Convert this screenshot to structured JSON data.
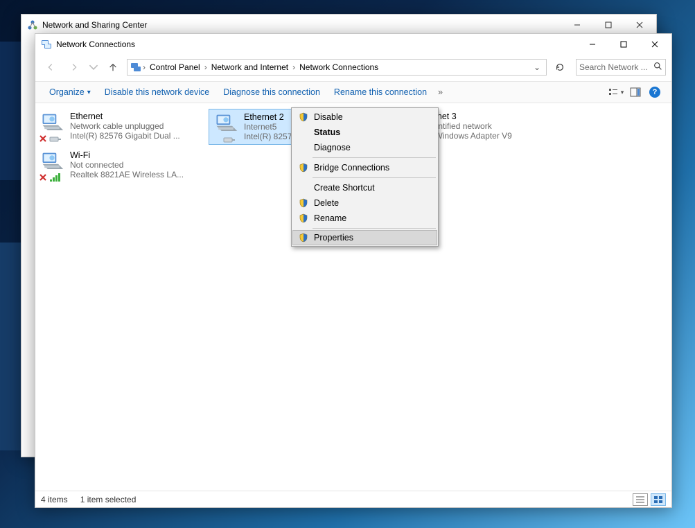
{
  "back_window": {
    "title": "Network and Sharing Center"
  },
  "window": {
    "title": "Network Connections"
  },
  "address": {
    "root_icon": "this-pc-networks-icon",
    "segments": [
      "Control Panel",
      "Network and Internet",
      "Network Connections"
    ]
  },
  "search": {
    "placeholder": "Search Network ..."
  },
  "toolbar": {
    "organize": "Organize",
    "disable": "Disable this network device",
    "diagnose": "Diagnose this connection",
    "rename": "Rename this connection"
  },
  "connections": [
    {
      "name": "Ethernet",
      "status": "Network cable unplugged",
      "device": "Intel(R) 82576 Gigabit Dual ...",
      "selected": false,
      "overlay": "disconnected"
    },
    {
      "name": "Ethernet 2",
      "status": "Internet5",
      "device": "Intel(R) 82576 Gigabit Dual ...",
      "selected": true,
      "overlay": "none"
    },
    {
      "name": "Ethernet 3",
      "status": "Unidentified network",
      "device": "TAP-Windows Adapter V9",
      "selected": false,
      "overlay": "none"
    },
    {
      "name": "Wi-Fi",
      "status": "Not connected",
      "device": "Realtek 8821AE Wireless LA...",
      "selected": false,
      "overlay": "wifi-disconnected"
    }
  ],
  "context_menu": {
    "items": [
      {
        "label": "Disable",
        "shield": true
      },
      {
        "label": "Status",
        "default": true
      },
      {
        "label": "Diagnose"
      },
      {
        "sep": true
      },
      {
        "label": "Bridge Connections",
        "shield": true
      },
      {
        "sep": true
      },
      {
        "label": "Create Shortcut"
      },
      {
        "label": "Delete",
        "shield": true
      },
      {
        "label": "Rename",
        "shield": true
      },
      {
        "sep": true
      },
      {
        "label": "Properties",
        "shield": true,
        "hover": true
      }
    ]
  },
  "statusbar": {
    "count": "4 items",
    "selection": "1 item selected"
  }
}
